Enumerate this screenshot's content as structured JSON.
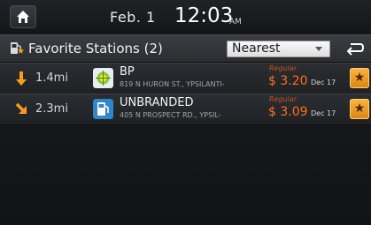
{
  "status_bar": {
    "date": "Feb. 1",
    "time": "12:03",
    "ampm": "AM"
  },
  "header": {
    "title": "Favorite Stations (2)",
    "sort": {
      "selected": "Nearest"
    }
  },
  "stations": [
    {
      "direction": "south",
      "distance": "1.4mi",
      "brand": "BP",
      "logo_color": "#e7eef0",
      "address": "819 N HURON ST., YPSILANTI-",
      "fuel_type": "Regular",
      "price": "$ 3.20",
      "price_date": "Dec 17"
    },
    {
      "direction": "southeast",
      "distance": "2.3mi",
      "brand": "UNBRANDED",
      "logo_color": "#2f86c9",
      "address": "405 N PROSPECT RD., YPSIL-",
      "fuel_type": "Regular",
      "price": "$ 3.09",
      "price_date": "Dec 17"
    }
  ],
  "colors": {
    "accent": "#ff6e20",
    "star": "#fdb43f"
  }
}
